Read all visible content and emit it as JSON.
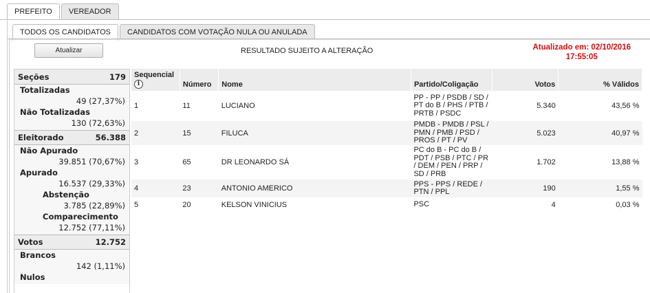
{
  "top_tabs": [
    {
      "label": "PREFEITO",
      "active": true
    },
    {
      "label": "VEREADOR",
      "active": false
    }
  ],
  "sub_tabs": [
    {
      "label": "TODOS OS CANDIDATOS",
      "active": true
    },
    {
      "label": "CANDIDATOS COM VOTAÇÃO NULA OU ANULADA",
      "active": false
    }
  ],
  "toolbar": {
    "refresh_label": "Atualizar",
    "notice": "RESULTADO SUJEITO A ALTERAÇÃO",
    "updated_line1": "Atualizado em: 02/10/2016",
    "updated_line2": "17:55:05"
  },
  "summary": {
    "secoes": {
      "label": "Seções",
      "value": "179"
    },
    "totalizadas": {
      "label": "Totalizadas",
      "value": "49 (27,37%)"
    },
    "nao_totalizadas": {
      "label": "Não Totalizadas",
      "value": "130 (72,63%)"
    },
    "eleitorado": {
      "label": "Eleitorado",
      "value": "56.388"
    },
    "nao_apurado": {
      "label": "Não Apurado",
      "value": "39.851 (70,67%)"
    },
    "apurado": {
      "label": "Apurado",
      "value": "16.537 (29,33%)"
    },
    "abstencao": {
      "label": "Abstenção",
      "value": "3.785 (22,89%)"
    },
    "comparecimento": {
      "label": "Comparecimento",
      "value": "12.752 (77,11%)"
    },
    "votos": {
      "label": "Votos",
      "value": "12.752"
    },
    "brancos": {
      "label": "Brancos",
      "value": "142 (1,11%)"
    },
    "nulos": {
      "label": "Nulos"
    }
  },
  "table": {
    "headers": {
      "sequencial": "Sequencial",
      "numero": "Número",
      "nome": "Nome",
      "partido": "Partido/Coligação",
      "votos": "Votos",
      "validos": "% Válidos"
    },
    "info_icon": "info-icon",
    "rows": [
      {
        "seq": "1",
        "numero": "11",
        "nome": "LUCIANO",
        "partido": "PP - PP / PSDB / SD / PT do B / PHS / PTB / PRTB / PSDC",
        "votos": "5.340",
        "validos": "43,56 %"
      },
      {
        "seq": "2",
        "numero": "15",
        "nome": "FILUCA",
        "partido": "PMDB - PMDB / PSL / PMN / PMB / PSD / PROS / PT / PV",
        "votos": "5.023",
        "validos": "40,97 %"
      },
      {
        "seq": "3",
        "numero": "65",
        "nome": "DR LEONARDO SÁ",
        "partido": "PC do B - PC do B / PDT / PSB / PTC / PR / DEM / PEN / PRP / SD / PRB",
        "votos": "1.702",
        "validos": "13,88 %"
      },
      {
        "seq": "4",
        "numero": "23",
        "nome": "ANTONIO AMERICO",
        "partido": "PPS - PPS / REDE / PTN / PPL",
        "votos": "190",
        "validos": "1,55 %"
      },
      {
        "seq": "5",
        "numero": "20",
        "nome": "KELSON VINICIUS",
        "partido": "PSC",
        "votos": "4",
        "validos": "0,03 %"
      }
    ]
  },
  "colors": {
    "updated_text": "#d01010",
    "header_bg": "#ececec",
    "alt_row_bg": "#f4f4f4"
  }
}
